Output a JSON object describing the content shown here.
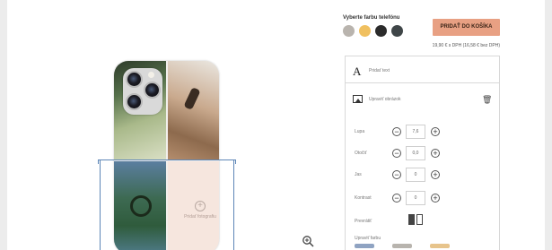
{
  "product": {
    "color_title": "Vyberte farbu telefónu",
    "colors": [
      "#b9b4ae",
      "#f0c060",
      "#2b2b2b",
      "#3f4648"
    ],
    "add_to_cart_label": "PRIDAŤ DO KOŠÍKA",
    "price": "19,90 € s DPH (16,58 € bez DPH)",
    "accent_color": "#e8a083"
  },
  "canvas": {
    "add_photo_label": "Pridať fotografiu"
  },
  "editor": {
    "add_text_label": "Pridať text",
    "edit_image_label": "Upraviť obrázok",
    "controls": [
      {
        "label": "Lupa",
        "value": "7,6"
      },
      {
        "label": "Otočiť",
        "value": "0,0"
      },
      {
        "label": "Jas",
        "value": "0"
      },
      {
        "label": "Kontrast",
        "value": "0"
      }
    ],
    "flip_label": "Prevrátiť",
    "color_edit_label": "Upraviť farbu",
    "filter_colors": [
      "#8fa3c2",
      "#b8b4ae",
      "#e7c48c"
    ]
  }
}
